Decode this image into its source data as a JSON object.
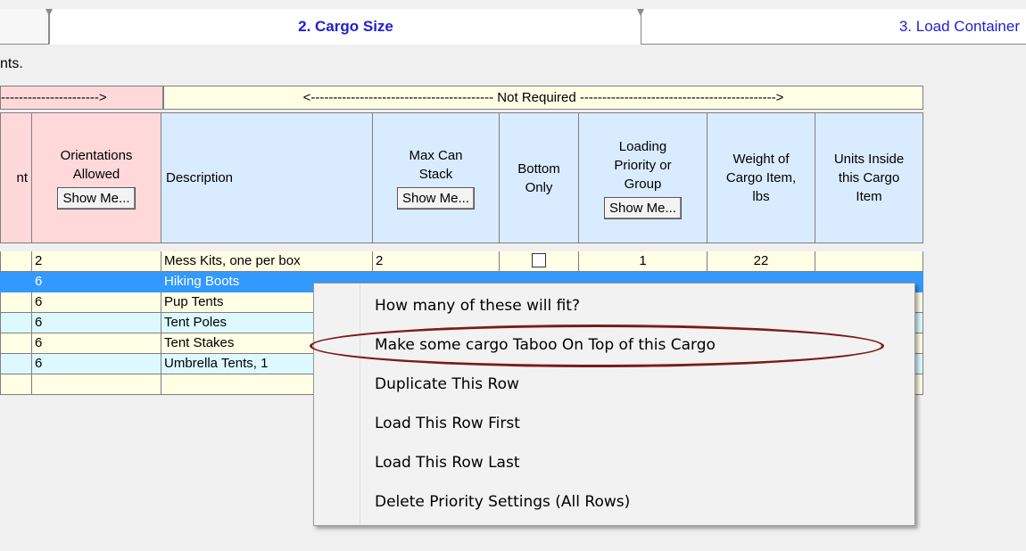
{
  "tabs": {
    "left_partial": "",
    "cargo_size": "2. Cargo Size",
    "load_container": "3. Load Container"
  },
  "fragment_text": "nts.",
  "bands": {
    "required": "---------------------->",
    "not_required": "<----------------------------------------- Not Required -------------------------------------------->"
  },
  "headers": {
    "partial": "nt",
    "orientations": "Orientations\nAllowed",
    "description": "Description",
    "max_stack": "Max Can\nStack",
    "bottom_only": "Bottom\nOnly",
    "priority": "Loading\nPriority or\nGroup",
    "weight": "Weight of\nCargo Item,\nlbs",
    "units": "Units Inside\nthis Cargo\nItem",
    "show_me": "Show Me..."
  },
  "rows": [
    {
      "orient": "2",
      "desc": "Mess Kits, one per box",
      "stack": "2",
      "priority": "1",
      "weight": "22"
    },
    {
      "orient": "6",
      "desc": "Hiking Boots"
    },
    {
      "orient": "6",
      "desc": "Pup Tents"
    },
    {
      "orient": "6",
      "desc": "Tent Poles"
    },
    {
      "orient": "6",
      "desc": "Tent Stakes"
    },
    {
      "orient": "6",
      "desc": "Umbrella Tents, 1"
    },
    {
      "orient": "",
      "desc": ""
    }
  ],
  "context_menu": {
    "items": [
      "How many of these will fit?",
      "Make some cargo Taboo On Top of this Cargo",
      "Duplicate This Row",
      "Load This Row First",
      "Load This Row Last",
      "Delete Priority Settings (All Rows)"
    ],
    "highlight_color": "#7d1a1a"
  },
  "colors": {
    "required": "#ffd9d9",
    "not_required": "#ffffe5",
    "header_blue": "#d9ecff",
    "selection": "#3399ff",
    "row_yellow": "#ffffe5",
    "row_cyan": "#ddf9ff"
  }
}
